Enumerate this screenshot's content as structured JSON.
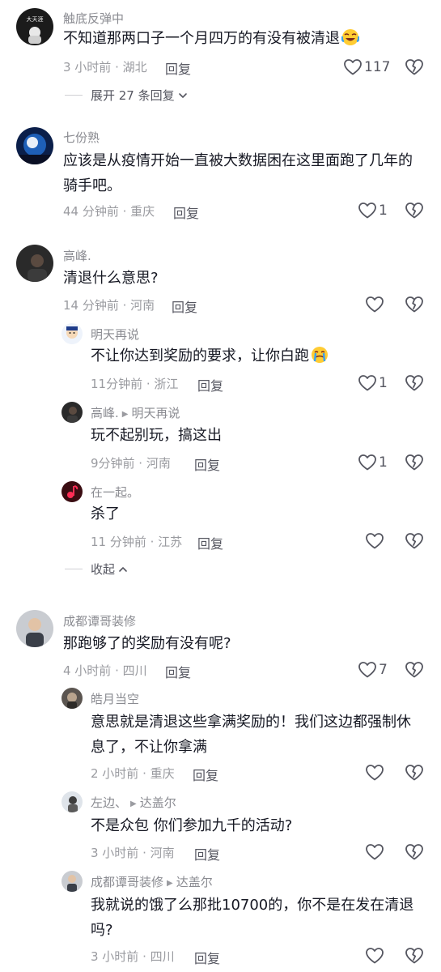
{
  "comments": [
    {
      "user": "触底反弹中",
      "text": "不知道那两口子一个月四万的有没有被清退",
      "time_location": "3 小时前 · 湖北",
      "reply_label": "回复",
      "likes": "117",
      "avatar_text": "大天涯",
      "expand_label": "展开 27 条回复"
    },
    {
      "user": "七份熟",
      "text_line1": "应该是从疫情开始一直被大数据困在这里面跑了几年的",
      "text_line2": "骑手吧。",
      "time_location": "44 分钟前 · 重庆",
      "reply_label": "回复",
      "likes": "1"
    },
    {
      "user": "高峰.",
      "text": "清退什么意思?",
      "time_location": "14 分钟前 · 河南",
      "reply_label": "回复",
      "replies": [
        {
          "user": "明天再说",
          "text": "不让你达到奖励的要求，让你白跑",
          "time_location": "11分钟前 · 浙江",
          "reply_label": "回复",
          "likes": "1"
        },
        {
          "user": "高峰.",
          "reply_to": "明天再说",
          "text": "玩不起别玩，搞这出",
          "time_location": "9分钟前 · 河南",
          "reply_label": "回复",
          "likes": "1"
        },
        {
          "user": "在一起。",
          "text": "杀了",
          "time_location": "11 分钟前 · 江苏",
          "reply_label": "回复"
        }
      ],
      "collapse_label": "收起"
    },
    {
      "user": "成都谭哥装修",
      "text": "那跑够了的奖励有没有呢?",
      "time_location": "4 小时前 · 四川",
      "reply_label": "回复",
      "likes": "7",
      "replies": [
        {
          "user": "皓月当空",
          "text_line1": "意思就是清退这些拿满奖励的！我们这边都强制休",
          "text_line2": "息了，不让你拿满",
          "time_location": "2 小时前 · 重庆",
          "reply_label": "回复"
        },
        {
          "user": "左边、",
          "reply_to": "达盖尔",
          "text": "不是众包 你们参加九千的活动?",
          "time_location": "3 小时前 · 河南",
          "reply_label": "回复"
        },
        {
          "user": "成都谭哥装修",
          "reply_to": "达盖尔",
          "text_line1": "我就说的饿了么那批10700的，你不是在发在清退",
          "text_line2": "吗?",
          "time_location": "3 小时前 · 四川",
          "reply_label": "回复"
        }
      ]
    }
  ],
  "icons": {
    "like": "heart-outline-icon",
    "dislike": "broken-heart-icon",
    "expand": "chevron-down-icon",
    "collapse": "chevron-up-icon"
  },
  "colors": {
    "text": "#161823",
    "secondary": "#8a8b91",
    "icon": "#555660"
  }
}
